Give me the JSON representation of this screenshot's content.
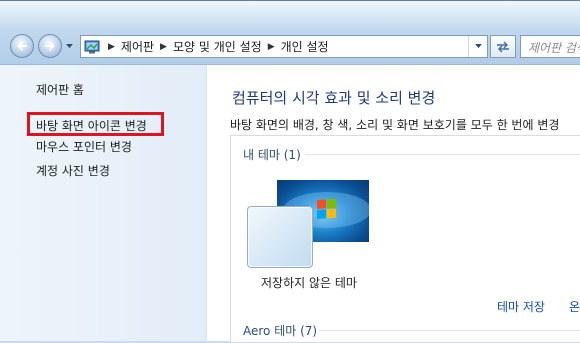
{
  "window": {
    "breadcrumbs": [
      "제어판",
      "모양 및 개인 설정",
      "개인 설정"
    ],
    "search_placeholder": "제어판 검색"
  },
  "sidebar": {
    "home": "제어판 홈",
    "items": [
      {
        "label": "바탕 화면 아이콘 변경",
        "highlighted": true
      },
      {
        "label": "마우스 포인터 변경",
        "highlighted": false
      },
      {
        "label": "계정 사진 변경",
        "highlighted": false
      }
    ]
  },
  "main": {
    "title": "컴퓨터의 시각 효과 및 소리 변경",
    "description": "바탕 화면의 배경, 창 색, 소리 및 화면 보호기를 모두 한 번에 변경",
    "groups": {
      "my_themes": "내 테마 (1)",
      "aero_themes": "Aero 테마 (7)"
    },
    "current_theme": "저장하지 않은 테마",
    "actions": {
      "save": "테마 저장",
      "online": "온"
    }
  },
  "colors": {
    "highlight_box": "#e0141e",
    "title_text": "#1e3e7a",
    "link_text": "#0f4fb0",
    "sidebar_bg": "#e8f0f9"
  },
  "icons": [
    "back-arrow-icon",
    "forward-arrow-icon",
    "control-panel-icon",
    "chevron-down-icon",
    "refresh-icon",
    "windows-logo-icon"
  ]
}
